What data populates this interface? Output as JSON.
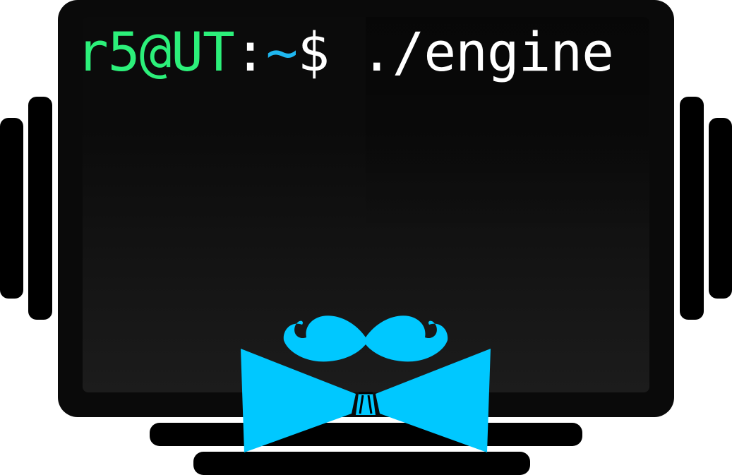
{
  "terminal": {
    "user_host": "r5@UT",
    "colon": ":",
    "path": "~",
    "dollar": "$",
    "command": " ./engine"
  },
  "colors": {
    "user_host": "#2cf07a",
    "path": "#1fb7f0",
    "text": "#ffffff",
    "bowtie": "#00c8ff",
    "frame": "#000000"
  },
  "icons": {
    "mustache": "mustache-icon",
    "bowtie": "bowtie-icon"
  }
}
